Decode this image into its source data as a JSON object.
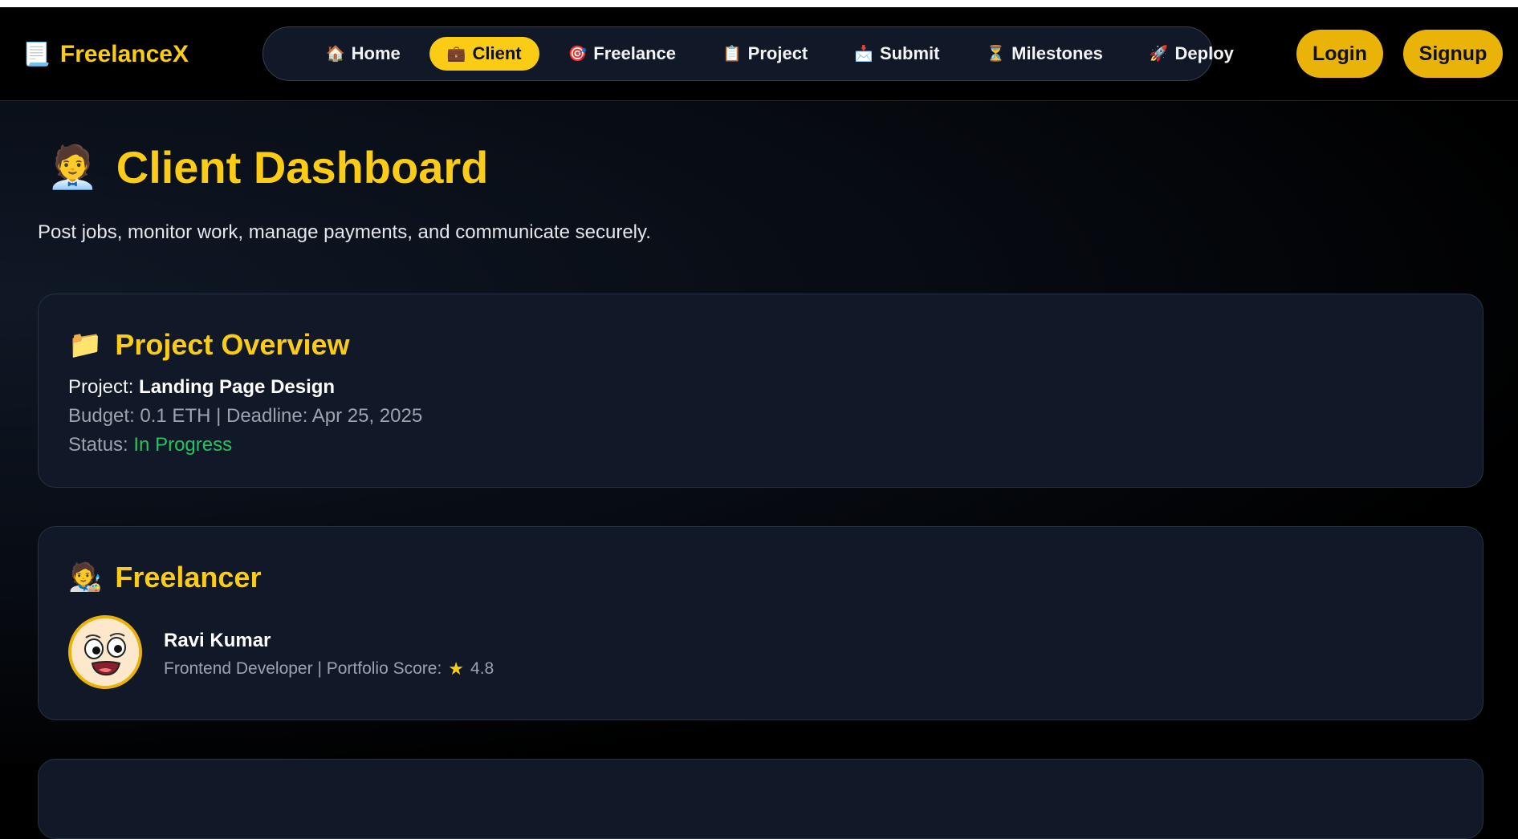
{
  "brand": {
    "icon": "clipboard-icon",
    "icon_glyph": "📃",
    "name": "FreelanceX"
  },
  "nav": {
    "items": [
      {
        "label": "Home",
        "icon": "house-icon",
        "glyph": "🏠"
      },
      {
        "label": "Client",
        "icon": "briefcase-icon",
        "glyph": "💼",
        "active": true
      },
      {
        "label": "Freelance",
        "icon": "target-icon",
        "glyph": "🎯"
      },
      {
        "label": "Project",
        "icon": "clipboard-icon",
        "glyph": "📋"
      },
      {
        "label": "Submit",
        "icon": "mailbox-icon",
        "glyph": "📩"
      },
      {
        "label": "Milestones",
        "icon": "hourglass-icon",
        "glyph": "⏳"
      },
      {
        "label": "Deploy",
        "icon": "rocket-icon",
        "glyph": "🚀"
      }
    ]
  },
  "auth": {
    "login_label": "Login",
    "signup_label": "Signup"
  },
  "page": {
    "title_icon": "businessperson-icon",
    "title_glyph": "🧑‍💼",
    "title": "Client Dashboard",
    "subtitle": "Post jobs, monitor work, manage payments, and communicate securely."
  },
  "project_overview": {
    "icon": "folder-icon",
    "glyph": "📁",
    "heading": "Project Overview",
    "project_label": "Project:",
    "project_name": "Landing Page Design",
    "budget_deadline": "Budget: 0.1 ETH | Deadline: Apr 25, 2025",
    "status_label": "Status:",
    "status_value": "In Progress"
  },
  "freelancer": {
    "icon": "artist-icon",
    "glyph": "🧑‍🎨",
    "heading": "Freelancer",
    "name": "Ravi Kumar",
    "meta": "Frontend Developer | Portfolio Score:",
    "score": "4.8"
  },
  "colors": {
    "accent": "#facc15",
    "status_green": "#22c55e",
    "card_bg": "#111827"
  }
}
